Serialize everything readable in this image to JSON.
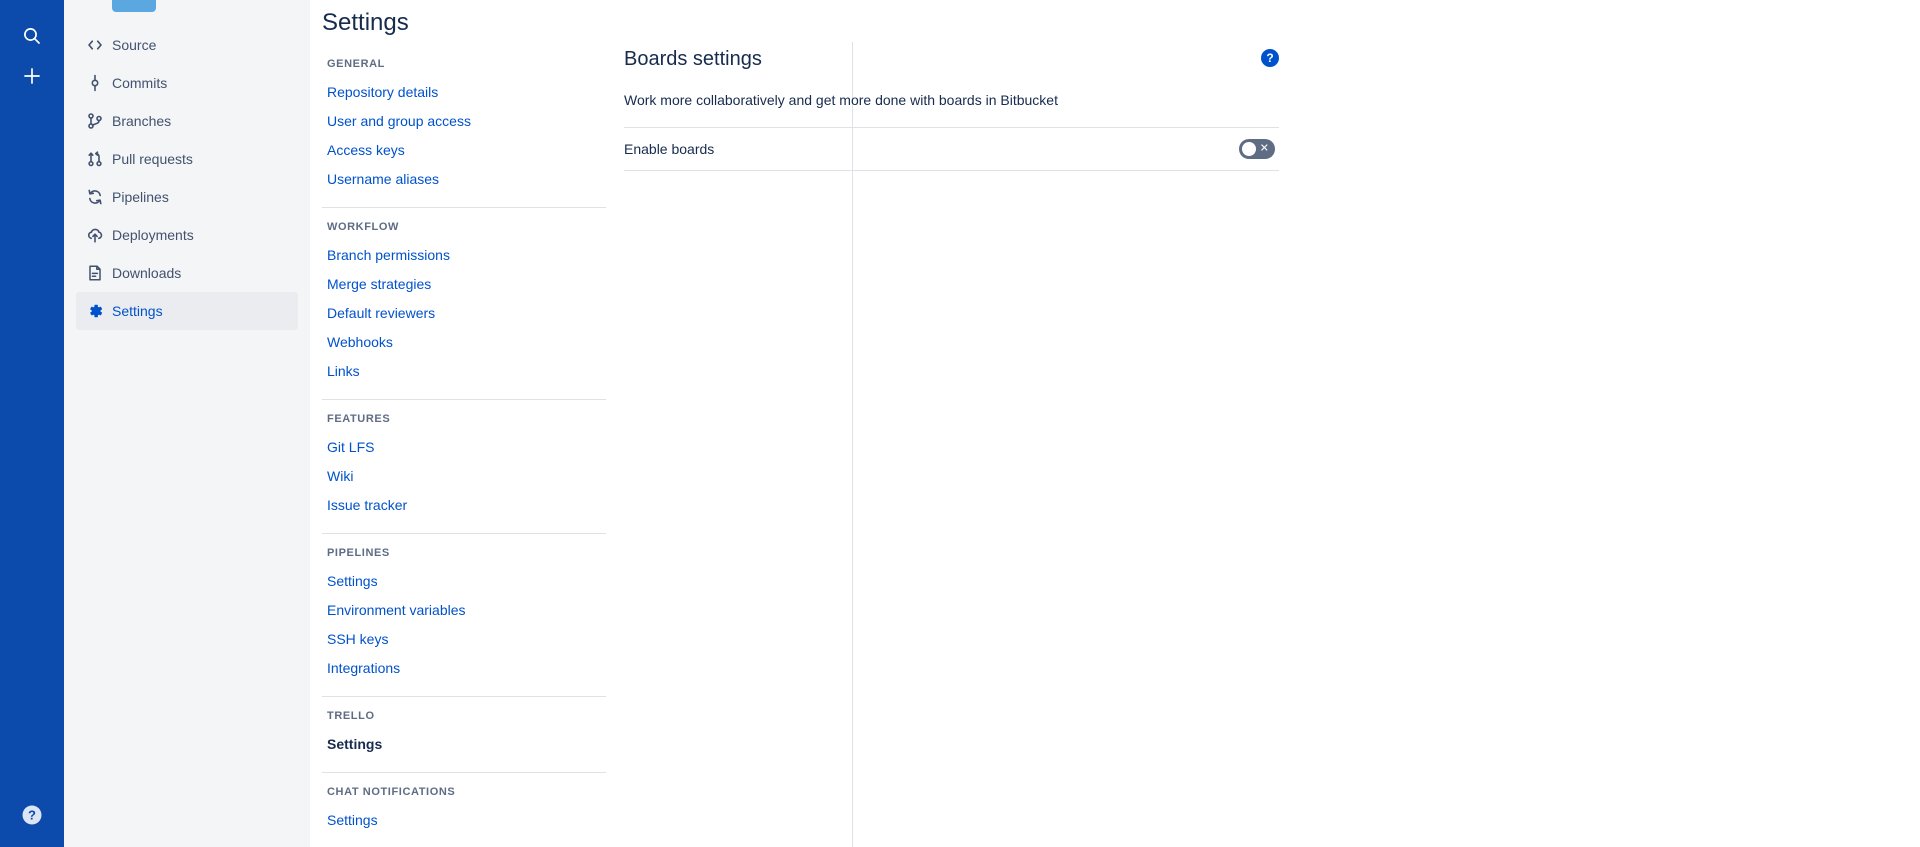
{
  "rail": {
    "search_icon": "search-icon",
    "create_icon": "plus-icon",
    "help_icon": "help-icon",
    "brand_color": "#0c4aab"
  },
  "repo_nav": {
    "items": [
      {
        "label": "Source",
        "icon": "code-icon",
        "active": false
      },
      {
        "label": "Commits",
        "icon": "commit-icon",
        "active": false
      },
      {
        "label": "Branches",
        "icon": "branches-icon",
        "active": false
      },
      {
        "label": "Pull requests",
        "icon": "pull-request-icon",
        "active": false
      },
      {
        "label": "Pipelines",
        "icon": "pipelines-icon",
        "active": false
      },
      {
        "label": "Deployments",
        "icon": "deployments-icon",
        "active": false
      },
      {
        "label": "Downloads",
        "icon": "downloads-icon",
        "active": false
      },
      {
        "label": "Settings",
        "icon": "gear-icon",
        "active": true
      }
    ]
  },
  "settings_nav": {
    "title": "Settings",
    "groups": [
      {
        "heading": "GENERAL",
        "links": [
          {
            "label": "Repository details",
            "current": false
          },
          {
            "label": "User and group access",
            "current": false
          },
          {
            "label": "Access keys",
            "current": false
          },
          {
            "label": "Username aliases",
            "current": false
          }
        ]
      },
      {
        "heading": "WORKFLOW",
        "links": [
          {
            "label": "Branch permissions",
            "current": false
          },
          {
            "label": "Merge strategies",
            "current": false
          },
          {
            "label": "Default reviewers",
            "current": false
          },
          {
            "label": "Webhooks",
            "current": false
          },
          {
            "label": "Links",
            "current": false
          }
        ]
      },
      {
        "heading": "FEATURES",
        "links": [
          {
            "label": "Git LFS",
            "current": false
          },
          {
            "label": "Wiki",
            "current": false
          },
          {
            "label": "Issue tracker",
            "current": false
          }
        ]
      },
      {
        "heading": "PIPELINES",
        "links": [
          {
            "label": "Settings",
            "current": false
          },
          {
            "label": "Environment variables",
            "current": false
          },
          {
            "label": "SSH keys",
            "current": false
          },
          {
            "label": "Integrations",
            "current": false
          }
        ]
      },
      {
        "heading": "TRELLO",
        "links": [
          {
            "label": "Settings",
            "current": true
          }
        ]
      },
      {
        "heading": "CHAT NOTIFICATIONS",
        "links": [
          {
            "label": "Settings",
            "current": false
          }
        ]
      }
    ]
  },
  "main": {
    "title": "Boards settings",
    "description": "Work more collaboratively and get more done with boards in Bitbucket",
    "help_icon": "help-icon",
    "help_glyph": "?",
    "setting": {
      "label": "Enable boards",
      "toggle_name": "enable-boards-toggle",
      "toggle_state": "off",
      "toggle_glyph": "✕"
    }
  },
  "colors": {
    "rail_blue": "#0c4aab",
    "link_blue": "#0052cc",
    "text_dark": "#172b4d",
    "muted": "#5e6c84",
    "divider": "#dfe1e6",
    "sidebar_bg": "#f4f5f7",
    "active_bg": "#ebecf0",
    "toggle_off": "#5e6c84"
  }
}
